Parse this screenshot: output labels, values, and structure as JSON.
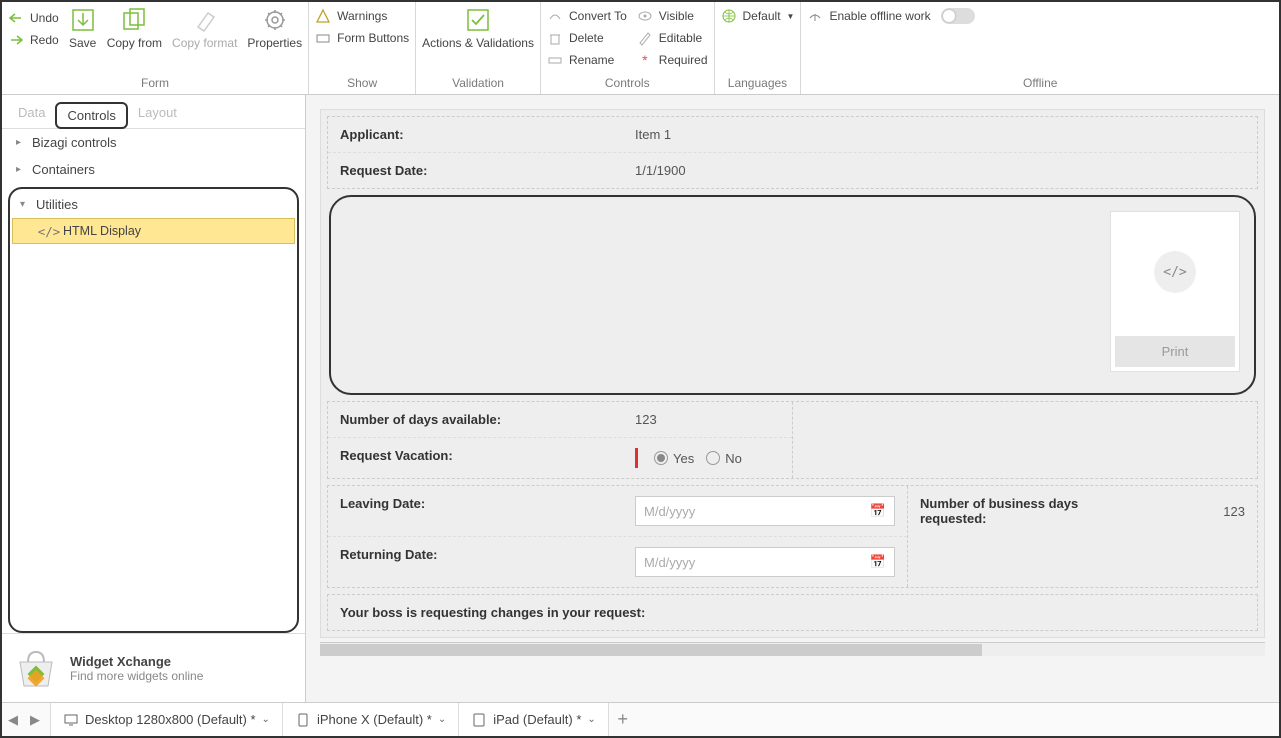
{
  "ribbon": {
    "undo": "Undo",
    "redo": "Redo",
    "save": "Save",
    "copy_from": "Copy from",
    "copy_format": "Copy format",
    "properties": "Properties",
    "group_form": "Form",
    "warnings": "Warnings",
    "form_buttons": "Form Buttons",
    "group_show": "Show",
    "actions_validations": "Actions & Validations",
    "group_validation": "Validation",
    "convert_to": "Convert To",
    "delete": "Delete",
    "rename": "Rename",
    "visible": "Visible",
    "editable": "Editable",
    "required": "Required",
    "group_controls": "Controls",
    "default": "Default",
    "group_languages": "Languages",
    "enable_offline": "Enable offline work",
    "group_offline": "Offline"
  },
  "left": {
    "tab_data": "Data",
    "tab_controls": "Controls",
    "tab_layout": "Layout",
    "bizagi_controls": "Bizagi controls",
    "containers": "Containers",
    "utilities": "Utilities",
    "html_display": "HTML Display",
    "widget_xchange": "Widget Xchange",
    "widget_sub": "Find more widgets online"
  },
  "form": {
    "applicant_label": "Applicant:",
    "applicant_value": "Item 1",
    "request_date_label": "Request Date:",
    "request_date_value": "1/1/1900",
    "print": "Print",
    "days_avail_label": "Number of days available:",
    "days_avail_value": "123",
    "request_vacation_label": "Request Vacation:",
    "yes": "Yes",
    "no": "No",
    "leaving_date_label": "Leaving Date:",
    "returning_date_label": "Returning Date:",
    "date_placeholder": "M/d/yyyy",
    "biz_days_label": "Number of business days requested:",
    "biz_days_value": "123",
    "boss_label": "Your boss is requesting changes in your request:"
  },
  "bottom": {
    "desktop": "Desktop 1280x800 (Default) *",
    "iphone": "iPhone X (Default) *",
    "ipad": "iPad (Default) *"
  }
}
